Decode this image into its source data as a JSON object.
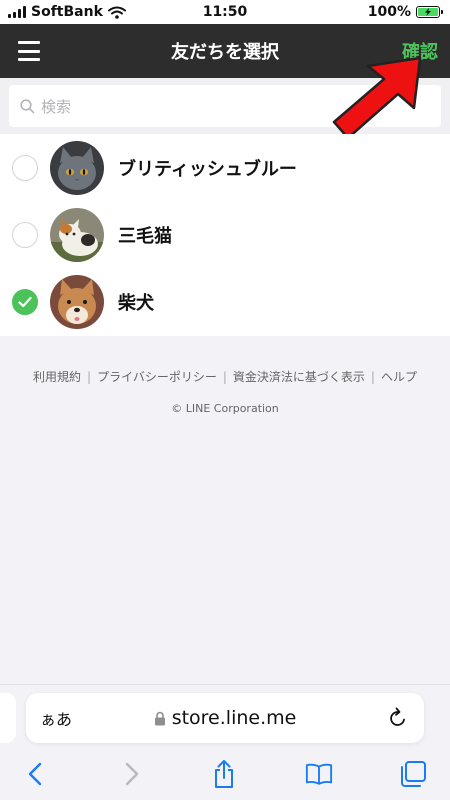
{
  "status_bar": {
    "carrier": "SoftBank",
    "time": "11:50",
    "battery": "100%"
  },
  "header": {
    "title": "友だちを選択",
    "confirm_label": "確認"
  },
  "search": {
    "placeholder": "検索"
  },
  "friends": [
    {
      "name": "ブリティッシュブルー",
      "selected": false,
      "avatar": "gray-cat-photo"
    },
    {
      "name": "三毛猫",
      "selected": false,
      "avatar": "calico-cat-photo"
    },
    {
      "name": "柴犬",
      "selected": true,
      "avatar": "shiba-dog-photo"
    }
  ],
  "footer": {
    "links": [
      "利用規約",
      "プライバシーポリシー",
      "資金決済法に基づく表示",
      "ヘルプ"
    ],
    "copyright": "© LINE Corporation"
  },
  "browser": {
    "aa_label": "ぁあ",
    "url": "store.line.me"
  },
  "colors": {
    "header_bg": "#2d2d2d",
    "accent_green": "#4cc25a",
    "arrow_red": "#ee1111",
    "ios_blue": "#1a7cf5"
  }
}
